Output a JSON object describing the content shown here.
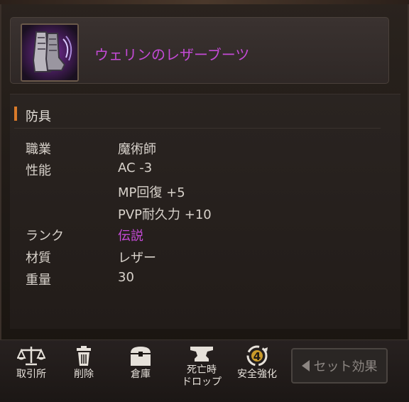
{
  "item": {
    "name": "ウェリンのレザーブーツ",
    "name_color": "#c44ad6",
    "icon": "leather-boots-icon"
  },
  "section": {
    "title": "防具"
  },
  "rows": [
    {
      "label": "職業",
      "value": "魔術師"
    },
    {
      "label": "性能",
      "value": "AC  -3"
    },
    {
      "label": "",
      "value": "MP回復  +5"
    },
    {
      "label": "",
      "value": "PVP耐久力  +10"
    },
    {
      "label": "ランク",
      "value": "伝説"
    },
    {
      "label": "材質",
      "value": "レザー"
    },
    {
      "label": "重量",
      "value": "30"
    }
  ],
  "toolbar": {
    "exchange": "取引所",
    "delete": "削除",
    "warehouse": "倉庫",
    "death_drop_1": "死亡時",
    "death_drop_2": "ドロップ",
    "safe_enhance": "安全強化",
    "safe_enhance_count": "4",
    "set_effect": "セット効果"
  }
}
